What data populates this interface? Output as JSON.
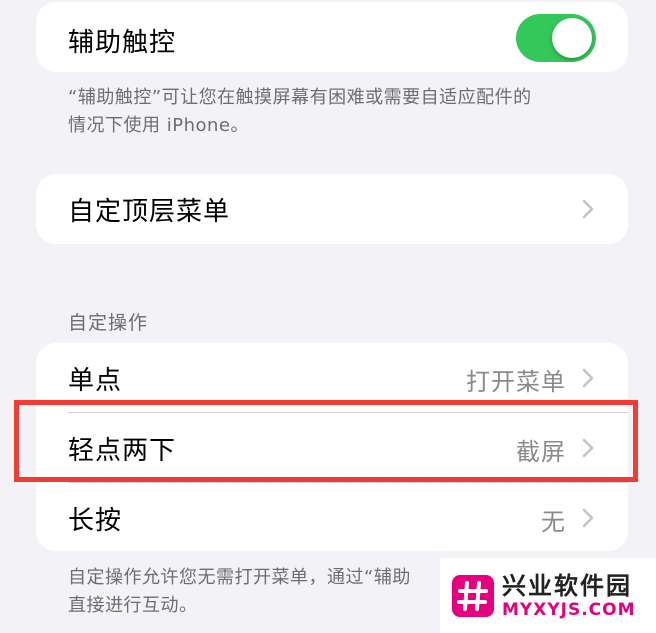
{
  "assistive_touch": {
    "label": "辅助触控",
    "toggle_on": true,
    "footnote_line1": "“辅助触控”可让您在触摸屏幕有困难或需要自适应配件的",
    "footnote_line2": "情况下使用 iPhone。"
  },
  "top_menu": {
    "label": "自定顶层菜单"
  },
  "custom_actions": {
    "header": "自定操作",
    "rows": [
      {
        "label": "单点",
        "value": "打开菜单"
      },
      {
        "label": "轻点两下",
        "value": "截屏"
      },
      {
        "label": "长按",
        "value": "无"
      }
    ],
    "footnote_line1": "自定操作允许您无需打开菜单，通过“辅助",
    "footnote_line2": "直接进行互动。"
  },
  "watermark": {
    "title": "兴业软件园",
    "subtitle": "MYXYJS.COM"
  },
  "colors": {
    "toggle_green": "#34c759",
    "highlight_red": "#f23b32",
    "watermark_pink": "#e4007f"
  },
  "icons": {
    "chevron": "chevron-right-icon",
    "watermark_logo": "hash-logo-icon"
  }
}
